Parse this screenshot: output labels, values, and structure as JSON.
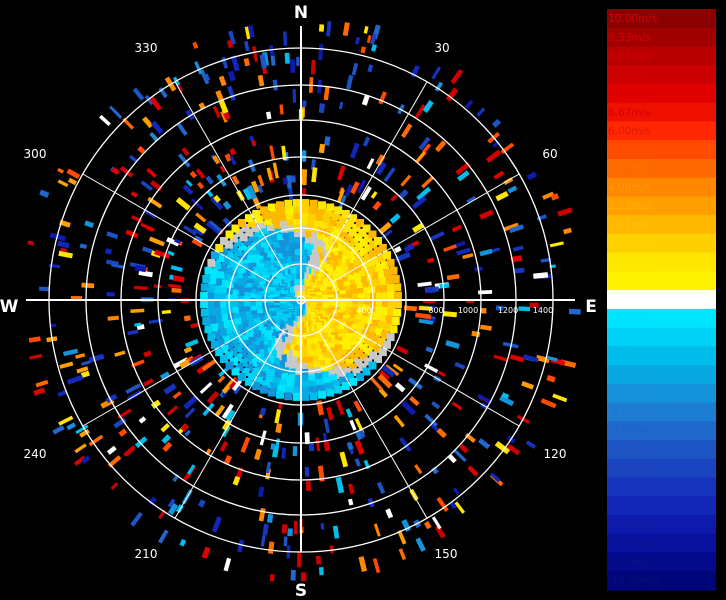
{
  "chart_data": {
    "type": "radar_ppi",
    "unit": "m/s",
    "cardinals": [
      "N",
      "E",
      "S",
      "W"
    ],
    "azimuth_labels": [
      "30",
      "60",
      "120",
      "150",
      "210",
      "240",
      "300",
      "330"
    ],
    "range_labels": [
      "400",
      "800",
      "1000",
      "1200",
      "1400"
    ],
    "legend": {
      "labels": [
        "10.00m/s",
        "9.33m/s",
        "8.67m/s",
        "8.00m/s",
        "7.33m/s",
        "6.67m/s",
        "6.00m/s",
        "5.33m/s",
        "4.67m/s",
        "4.00m/s",
        "3.33m/s",
        "2.67m/s",
        "2.00m/s",
        "1.33m/s",
        "0.67m/s",
        "0.00m/s",
        "-0.67m/s",
        "-1.33m/s",
        "-2.00m/s",
        "-2.67m/s",
        "-3.33m/s",
        "-4.00m/s",
        "-4.67m/s",
        "-5.33m/s",
        "-6.00m/s",
        "-6.67m/s",
        "-7.33m/s",
        "-8.00m/s",
        "-8.67m/s",
        "-9.33m/s",
        "-10.00m/s"
      ],
      "colors": [
        "#8b0000",
        "#a00000",
        "#b80000",
        "#cc0000",
        "#e00000",
        "#f01000",
        "#ff2800",
        "#ff4a00",
        "#ff6a00",
        "#ff8800",
        "#ffa000",
        "#ffb800",
        "#ffd000",
        "#ffe600",
        "#fff200",
        "#ffffff",
        "#00e5ff",
        "#00d2f5",
        "#00bdeb",
        "#08a8e3",
        "#1493db",
        "#1c7ed3",
        "#2068cc",
        "#1d55c4",
        "#1a44c0",
        "#1634bd",
        "#1226b8",
        "#0d1aac",
        "#08109d",
        "#040a8c",
        "#00067a"
      ],
      "text_colors": [
        "#d40000",
        "#d40000",
        "#d40000",
        "#d40000",
        "#d40000",
        "#d40000",
        "#e01800",
        "#ff5000",
        "#ff7000",
        "#ff9a00",
        "#ffb000",
        "#ffc400",
        "#ffd800",
        "#ffe800",
        "#fff200",
        "#ffffff",
        "#00e0ff",
        "#00d0f5",
        "#00bceb",
        "#10a4e2",
        "#1a8ad8",
        "#2274cf",
        "#2262c8",
        "#1f52c2",
        "#1c44bd",
        "#1836b8",
        "#1428b2",
        "#10209e",
        "#0c1890",
        "#081480",
        "#061070"
      ]
    }
  }
}
